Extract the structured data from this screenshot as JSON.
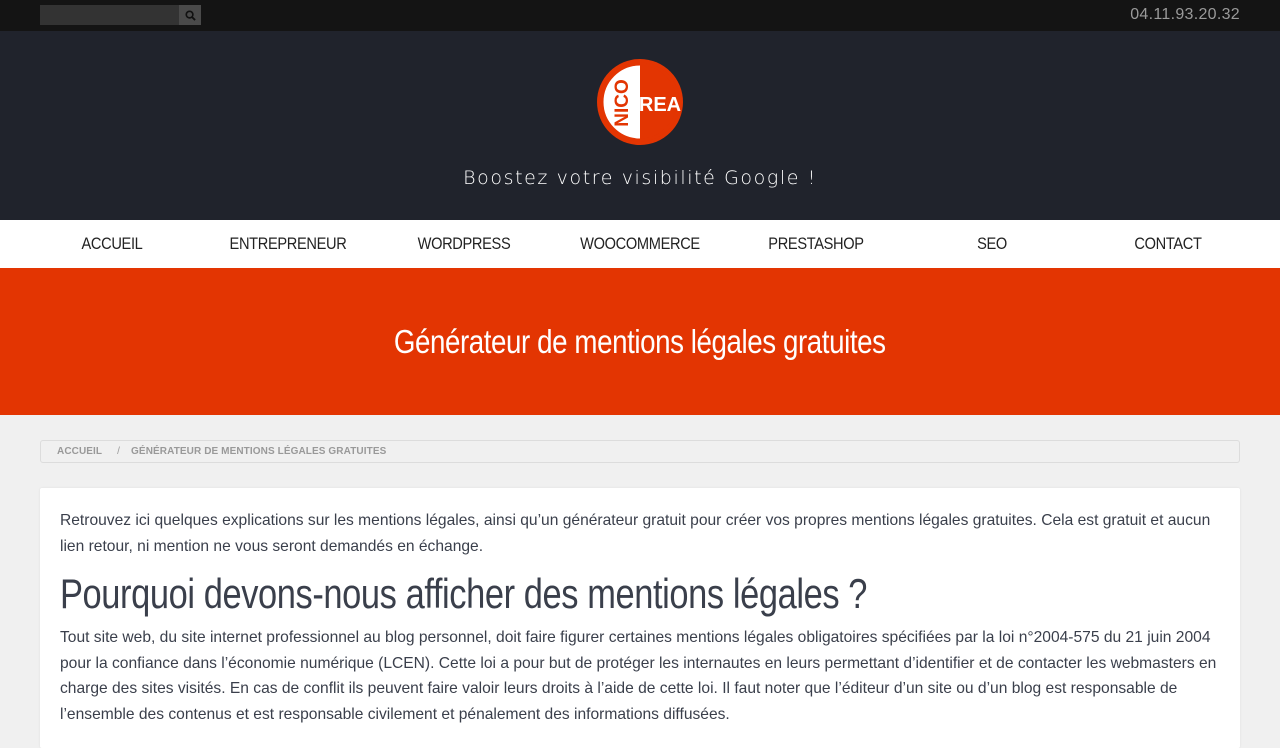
{
  "topbar": {
    "search_placeholder": "",
    "phone": "04.11.93.20.32"
  },
  "header": {
    "logo_text_left": "NICO",
    "logo_text_right": "REA",
    "tagline": "Boostez votre visibilité Google !"
  },
  "nav": {
    "items": [
      {
        "label": "ACCUEIL"
      },
      {
        "label": "ENTREPRENEUR"
      },
      {
        "label": "WORDPRESS"
      },
      {
        "label": "WOOCOMMERCE"
      },
      {
        "label": "PRESTASHOP"
      },
      {
        "label": "SEO"
      },
      {
        "label": "CONTACT"
      }
    ]
  },
  "hero": {
    "title": "Générateur de mentions légales gratuites"
  },
  "breadcrumb": {
    "home": "ACCUEIL",
    "separator": "/",
    "current": "GÉNÉRATEUR DE MENTIONS LÉGALES GRATUITES"
  },
  "content": {
    "intro": "Retrouvez ici quelques explications sur les mentions légales, ainsi qu’un générateur gratuit pour créer vos propres mentions légales gratuites. Cela est gratuit et aucun lien retour, ni mention ne vous seront demandés en échange.",
    "heading": "Pourquoi devons-nous afficher des mentions légales ?",
    "paragraph": "Tout site web, du site internet professionnel au blog personnel, doit faire figurer certaines mentions légales obligatoires spécifiées par la loi n°2004-575 du 21 juin 2004 pour la confiance dans l’économie numérique (LCEN). Cette loi a pour but de protéger les internautes en leurs permettant d’identifier et de contacter les webmasters en charge des sites visités. En cas de conflit ils peuvent faire valoir leurs droits à l’aide de cette loi. Il faut noter que l’éditeur d’un site ou d’un blog est responsable de l’ensemble des contenus et est responsable civilement et pénalement des informations diffusées."
  },
  "colors": {
    "accent": "#e33502",
    "header_bg": "#20232c",
    "topbar_bg": "#141414"
  }
}
